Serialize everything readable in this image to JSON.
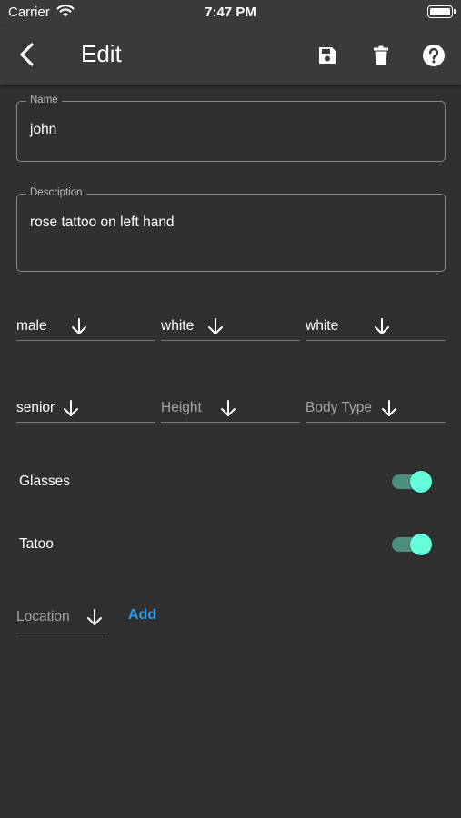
{
  "status_bar": {
    "carrier": "Carrier",
    "time": "7:47 PM"
  },
  "app_bar": {
    "title": "Edit",
    "icons": [
      "back-arrow-icon",
      "save-icon",
      "delete-icon",
      "help-icon"
    ]
  },
  "form": {
    "name": {
      "label": "Name",
      "value": "john"
    },
    "description": {
      "label": "Description",
      "value": "rose tattoo on left hand"
    },
    "dropdowns_row1": [
      {
        "id": "gender",
        "value": "male",
        "is_hint": false
      },
      {
        "id": "race",
        "value": "white",
        "is_hint": false
      },
      {
        "id": "hair",
        "value": "white",
        "is_hint": false
      }
    ],
    "dropdowns_row2": [
      {
        "id": "age",
        "value": "senior",
        "is_hint": false
      },
      {
        "id": "height",
        "value": "Height",
        "is_hint": true
      },
      {
        "id": "body-type",
        "value": "Body Type",
        "is_hint": true
      }
    ],
    "toggles": [
      {
        "label": "Glasses",
        "on": true
      },
      {
        "label": "Tatoo",
        "on": true
      }
    ],
    "location": {
      "value": "Location",
      "is_hint": true
    },
    "add_label": "Add"
  },
  "colors": {
    "background": "#303030",
    "app_bar": "#3a3a3a",
    "switch_thumb": "#64ffda",
    "switch_track": "#4c8e80",
    "link": "#2a9df4"
  }
}
